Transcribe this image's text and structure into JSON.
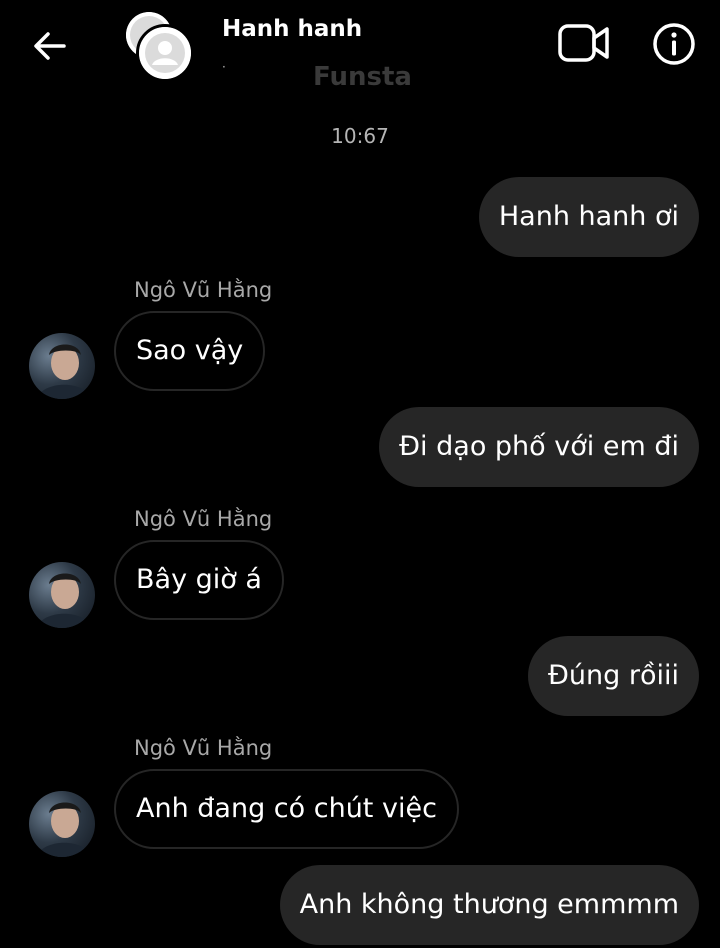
{
  "header": {
    "title": "Hanh hanh",
    "subtitle": "·",
    "watermark": "Funsta"
  },
  "timestamp": "10:67",
  "messages": [
    {
      "direction": "out",
      "text": "Hanh hanh ơi"
    },
    {
      "direction": "in",
      "sender": "Ngô Vũ Hằng",
      "text": "Sao vậy"
    },
    {
      "direction": "out",
      "text": "Đi dạo phố với em đi"
    },
    {
      "direction": "in",
      "sender": "Ngô Vũ Hằng",
      "text": "Bây giờ á"
    },
    {
      "direction": "out",
      "text": "Đúng rồiii"
    },
    {
      "direction": "in",
      "sender": "Ngô Vũ Hằng",
      "text": "Anh đang có chút việc"
    },
    {
      "direction": "out",
      "text": "Anh không thương emmmm"
    }
  ],
  "colors": {
    "background": "#000000",
    "bubble_out": "#262626",
    "bubble_in_border": "#262626",
    "text": "#ffffff",
    "muted_text": "#a8a8a8"
  },
  "icons": [
    "back-arrow-icon",
    "video-call-icon",
    "info-icon",
    "default-avatar-icon"
  ]
}
